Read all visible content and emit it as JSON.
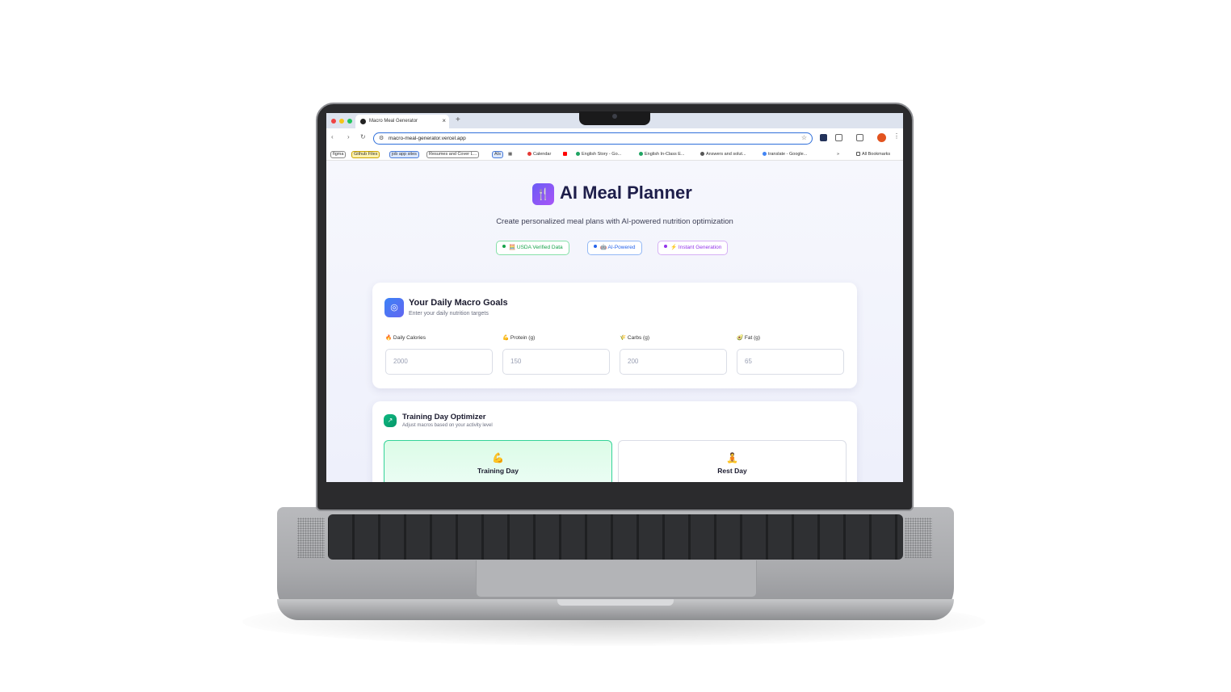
{
  "browser": {
    "tab_title": "Macro Meal Generator",
    "tab_close": "×",
    "new_tab": "+",
    "url": "macro-meal-generator.vercel.app",
    "bookmarks": [
      "figma",
      "Github Files",
      "job app sites",
      "Resumes and Cover L...",
      "AIs",
      "Calendar",
      "English Story - Go...",
      "English In-Class E...",
      "Answers and solut...",
      "translate - Google...",
      "»",
      "All Bookmarks"
    ]
  },
  "app": {
    "logo_glyph": "🍴",
    "title": "AI Meal Planner",
    "subtitle": "Create personalized meal plans with AI-powered nutrition optimization",
    "badges": [
      {
        "label": "🧮 USDA Verified Data",
        "color": "#16a34a",
        "border": "#86e0a8"
      },
      {
        "label": "🤖 AI-Powered",
        "color": "#2563eb",
        "border": "#93b8f5"
      },
      {
        "label": "⚡ Instant Generation",
        "color": "#9333ea",
        "border": "#d6b0f5"
      }
    ]
  },
  "macro_goals": {
    "icon": "target-icon",
    "title": "Your Daily Macro Goals",
    "subtitle": "Enter your daily nutrition targets",
    "fields": [
      {
        "emoji": "🔥",
        "label": "Daily Calories",
        "placeholder": "2000"
      },
      {
        "emoji": "💪",
        "label": "Protein (g)",
        "placeholder": "150"
      },
      {
        "emoji": "🌾",
        "label": "Carbs (g)",
        "placeholder": "200"
      },
      {
        "emoji": "🥑",
        "label": "Fat (g)",
        "placeholder": "65"
      }
    ]
  },
  "training": {
    "icon": "trend-icon",
    "title": "Training Day Optimizer",
    "subtitle": "Adjust macros based on your activity level",
    "options": [
      {
        "emoji": "💪",
        "label": "Training Day",
        "selected": true
      },
      {
        "emoji": "🧘",
        "label": "Rest Day",
        "selected": false
      }
    ]
  }
}
